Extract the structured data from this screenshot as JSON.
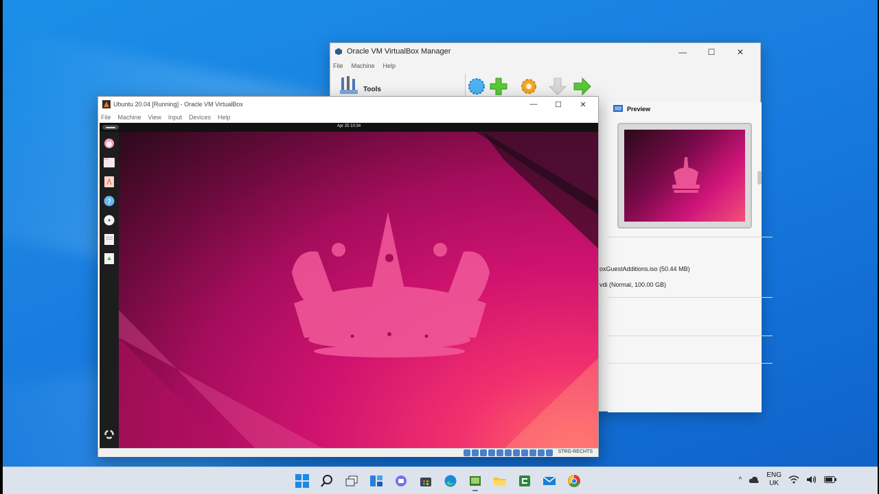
{
  "vbox_manager": {
    "title": "Oracle VM VirtualBox Manager",
    "menu": [
      "File",
      "Machine",
      "Help"
    ],
    "tools_label": "Tools",
    "preview_label": "Preview",
    "details": [
      "oxGuestAdditions.iso (50.44 MB)",
      "vdi (Normal, 100.00 GB)"
    ]
  },
  "vm_window": {
    "title": "Ubuntu 20.04 [Running] - Oracle VM VirtualBox",
    "menu": [
      "File",
      "Machine",
      "View",
      "Input",
      "Devices",
      "Help"
    ],
    "clock": "Apr 25  10:34",
    "host_key": "STRG-RECHTS"
  },
  "taskbar": {
    "lang_top": "ENG",
    "lang_bottom": "UK",
    "apps": [
      "start-icon",
      "search-icon",
      "task-view-icon",
      "widgets-icon",
      "chat-icon",
      "store-icon",
      "edge-icon",
      "virtualbox-icon",
      "file-explorer-icon",
      "camtasia-icon",
      "mail-icon",
      "chrome-icon"
    ]
  },
  "colors": {
    "desktop_blue": "#1a7fe0",
    "ubuntu_magenta": "#d0136f",
    "crown": "#f25a9a"
  }
}
